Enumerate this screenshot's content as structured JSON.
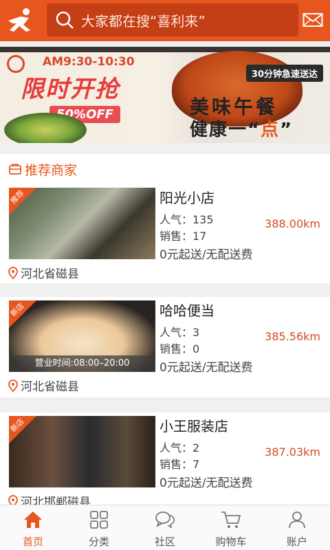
{
  "header": {
    "search_placeholder": "大家都在搜“喜利来”",
    "brand_color": "#e8561f"
  },
  "banner": {
    "time": "AM9:30-10:30",
    "headline": "限时开抢",
    "discount": "50%OFF",
    "badge": "30分钟急速送达",
    "slogan_line1": "美味午餐",
    "slogan_line2_prefix": "健康一“",
    "slogan_line2_accent": "点",
    "slogan_line2_suffix": "”"
  },
  "section": {
    "title": "推荐商家"
  },
  "shops": [
    {
      "badge": "推荐",
      "name": "阳光小店",
      "popularity": "人气：135",
      "sales": "销售：17",
      "delivery": "0元起送/无配送费",
      "distance": "388.00km",
      "location": "河北省磁县",
      "hours": ""
    },
    {
      "badge": "新店",
      "name": "哈哈便当",
      "popularity": "人气：3",
      "sales": "销售：0",
      "delivery": "0元起送/无配送费",
      "distance": "385.56km",
      "location": "河北省磁县",
      "hours": "营业时间:08:00–20:00"
    },
    {
      "badge": "新店",
      "name": "小王服装店",
      "popularity": "人气：2",
      "sales": "销售：7",
      "delivery": "0元起送/无配送费",
      "distance": "387.03km",
      "location": "河北邯郸磁县",
      "hours": ""
    }
  ],
  "nav": {
    "items": [
      {
        "label": "首页",
        "icon": "home-icon",
        "active": true
      },
      {
        "label": "分类",
        "icon": "grid-icon",
        "active": false
      },
      {
        "label": "社区",
        "icon": "chat-icon",
        "active": false
      },
      {
        "label": "购物车",
        "icon": "cart-icon",
        "active": false
      },
      {
        "label": "账户",
        "icon": "user-icon",
        "active": false
      }
    ]
  }
}
